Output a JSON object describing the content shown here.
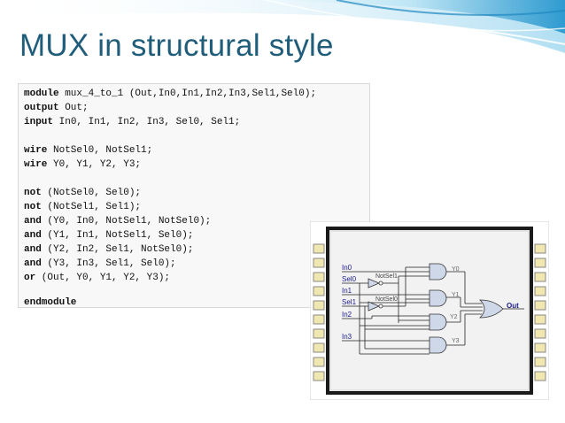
{
  "slide": {
    "title": "MUX in structural style"
  },
  "code": {
    "lines": [
      {
        "keyword": "module",
        "text": " mux_4_to_1 (Out,In0,In1,In2,In3,Sel1,Sel0);"
      },
      {
        "keyword": "output",
        "text": " Out;"
      },
      {
        "keyword": "input",
        "text": " In0, In1, In2, In3, Sel0, Sel1;"
      },
      {
        "keyword": "",
        "text": ""
      },
      {
        "keyword": "wire",
        "text": " NotSel0, NotSel1;"
      },
      {
        "keyword": "wire",
        "text": " Y0, Y1, Y2, Y3;"
      },
      {
        "keyword": "",
        "text": ""
      },
      {
        "keyword": "not",
        "text": " (NotSel0, Sel0);"
      },
      {
        "keyword": "not",
        "text": " (NotSel1, Sel1);"
      },
      {
        "keyword": "and",
        "text": " (Y0, In0, NotSel1, NotSel0);"
      },
      {
        "keyword": "and",
        "text": " (Y1, In1, NotSel1, Sel0);"
      },
      {
        "keyword": "and",
        "text": " (Y2, In2, Sel1, NotSel0);"
      },
      {
        "keyword": "and",
        "text": " (Y3, In3, Sel1, Sel0);"
      },
      {
        "keyword": "or",
        "text": " (Out, Y0, Y1, Y2, Y3);"
      },
      {
        "keyword": "",
        "text": ""
      },
      {
        "keyword": "endmodule",
        "text": ""
      }
    ]
  },
  "schematic": {
    "inputs": [
      "In0",
      "Sel0",
      "In1",
      "Sel1",
      "In2",
      "In3"
    ],
    "inverter_labels": [
      "NotSel1",
      "NotSel0"
    ],
    "gate_outputs": [
      "Y0",
      "Y1",
      "Y2",
      "Y3"
    ],
    "output": "Out"
  },
  "colors": {
    "title": "#1f5d7a",
    "banner_wave": "#3fa6d6",
    "chip_body": "#e3e3e3",
    "chip_border": "#1a1a1a",
    "pin_fill": "#f0e8b0",
    "label_blue": "#1a1a8c"
  }
}
